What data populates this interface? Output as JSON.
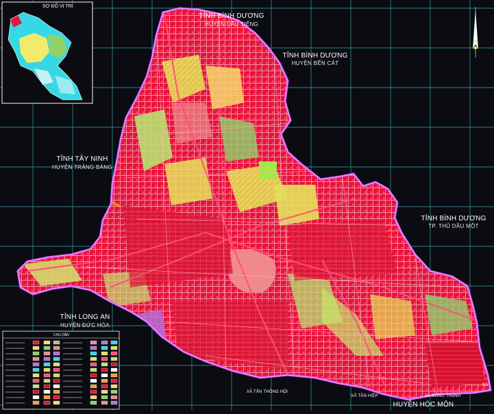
{
  "inset": {
    "title": "SƠ ĐỒ VỊ TRÍ"
  },
  "labels": {
    "bd_north_province": "TỈNH BÌNH DƯƠNG",
    "bd_north_district": "HUYỆN DẦU TIẾNG",
    "bd_ne_province": "TỈNH BÌNH DƯƠNG",
    "bd_ne_district": "HUYỆN BẾN CÁT",
    "tayninh_province": "TỈNH TÂY NINH",
    "tayninh_district": "HUYỆN TRẢNG BÀNG",
    "bd_east_province": "TỈNH BÌNH DƯƠNG",
    "bd_east_district": "TP. THỦ DẦU MỘT",
    "longan_province": "TỈNH LONG AN",
    "longan_district": "HUYỆN ĐỨC HÒA",
    "commune_tanthongnhi": "XÃ TÂN THÔNG HỘI",
    "commune_tanhiep": "XÃ TÂN HIỆP",
    "district_hocmon": "HUYỆN HÓC MÔN",
    "commune_dongthanh": "XÃ ĐÔNG THẠNH",
    "commune_xa": "XA"
  },
  "legend": {
    "title": "CHÚ DẪN"
  },
  "colors": {
    "background": "#0b0b12",
    "grid": "#2fa3a8",
    "district_fill": "#e8143c",
    "boundary": "#d65cff",
    "yellow_zone": "#e6e05a",
    "green_zone": "#8fd16a",
    "salmon_zone": "#f08a8a",
    "inset_cyan": "#36d8e6",
    "inset_yellow": "#f2ea6a"
  },
  "icons": {
    "north_arrow": "north-arrow-icon"
  }
}
